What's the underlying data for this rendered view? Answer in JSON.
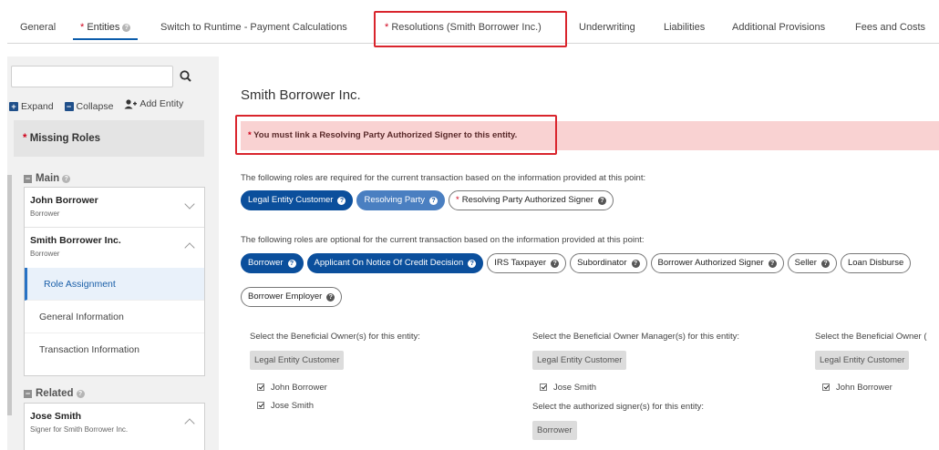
{
  "tabs": [
    {
      "label": "General",
      "required": false
    },
    {
      "label": "Entities",
      "required": true,
      "active": true
    },
    {
      "label": "Switch to Runtime - Payment Calculations",
      "required": false
    },
    {
      "label": "Resolutions (Smith Borrower Inc.)",
      "required": true
    },
    {
      "label": "Underwriting",
      "required": false
    },
    {
      "label": "Liabilities",
      "required": false
    },
    {
      "label": "Additional Provisions",
      "required": false
    },
    {
      "label": "Fees and Costs",
      "required": false
    }
  ],
  "required_marker": "*",
  "left": {
    "search": {
      "value": "",
      "placeholder": ""
    },
    "expand_label": "Expand",
    "collapse_label": "Collapse",
    "add_entity_label": "Add Entity",
    "missing_roles_label": "Missing Roles",
    "main_section": "Main",
    "related_section": "Related",
    "entities": [
      {
        "name": "John Borrower",
        "role": "Borrower"
      },
      {
        "name": "Smith Borrower Inc.",
        "role": "Borrower"
      }
    ],
    "subitems": [
      "Role Assignment",
      "General Information",
      "Transaction Information"
    ],
    "related": [
      {
        "name": "Jose Smith",
        "role": "Signer for Smith Borrower Inc."
      }
    ]
  },
  "main": {
    "title": "Smith Borrower Inc.",
    "alert": "You must link a Resolving Party Authorized Signer to this entity.",
    "required_desc": "The following roles are required for the current transaction based on the information provided at this point:",
    "required_roles": [
      "Legal Entity Customer",
      "Resolving Party",
      "Resolving Party Authorized Signer"
    ],
    "optional_desc": "The following roles are optional for the current transaction based on the information provided at this point:",
    "optional_roles": [
      "Borrower",
      "Applicant On Notice Of Credit Decision",
      "IRS Taxpayer",
      "Subordinator",
      "Borrower Authorized Signer",
      "Seller",
      "Loan Disburse"
    ],
    "optional_roles_row2": [
      "Borrower Employer"
    ],
    "beneficial": [
      {
        "label": "Select the Beneficial Owner(s) for this entity:",
        "pill": "Legal Entity Customer",
        "checks": [
          "John Borrower",
          "Jose Smith"
        ]
      },
      {
        "label": "Select the Beneficial Owner Manager(s) for this entity:",
        "pill": "Legal Entity Customer",
        "checks": [
          "Jose Smith"
        ]
      },
      {
        "label": "Select the Beneficial Owner (",
        "pill": "Legal Entity Customer",
        "checks": [
          "John Borrower"
        ]
      }
    ],
    "authorized_signer": {
      "label": "Select the authorized signer(s) for this entity:",
      "pill": "Borrower"
    }
  },
  "colors": {
    "accent": "#0b4f9c",
    "alert_bg": "#f9d2d2",
    "highlight_box": "#d9252d",
    "required": "#d0021b"
  }
}
